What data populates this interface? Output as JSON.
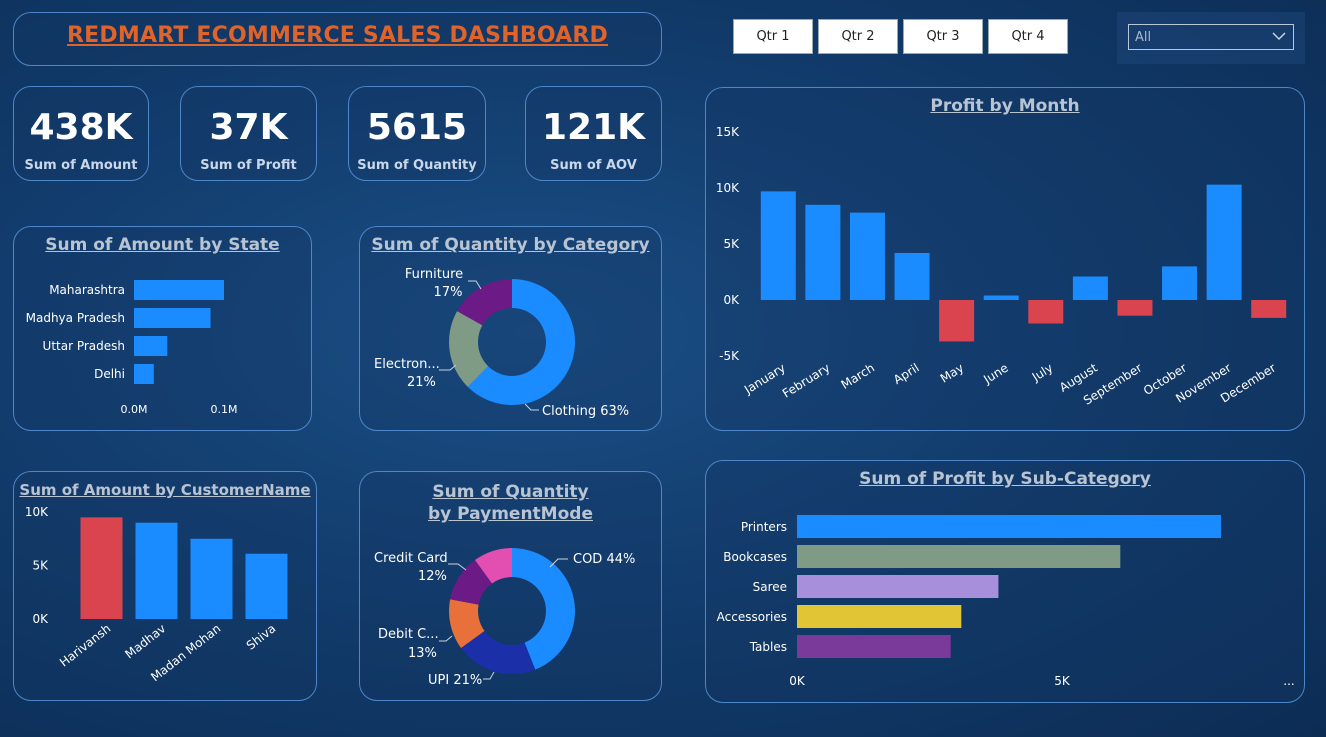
{
  "header": {
    "title": "REDMART ECOMMERCE SALES DASHBOARD"
  },
  "kpis": [
    {
      "value": "438K",
      "label": "Sum of Amount"
    },
    {
      "value": "37K",
      "label": "Sum of Profit"
    },
    {
      "value": "5615",
      "label": "Sum of Quantity"
    },
    {
      "value": "121K",
      "label": "Sum of AOV"
    }
  ],
  "quarter_buttons": [
    "Qtr 1",
    "Qtr 2",
    "Qtr 3",
    "Qtr 4"
  ],
  "slicer": {
    "value": "All"
  },
  "colors": {
    "accent": "#1a8cff",
    "negative": "#d9444f",
    "title_orange": "#e0642a"
  },
  "chart_data": [
    {
      "id": "state",
      "type": "bar",
      "orientation": "horizontal",
      "title": "Sum of Amount by State",
      "categories": [
        "Maharashtra",
        "Madhya Pradesh",
        "Uttar Pradesh",
        "Delhi"
      ],
      "values": [
        0.1,
        0.085,
        0.037,
        0.022
      ],
      "xlim": [
        0,
        0.15
      ],
      "x_ticks": [
        {
          "v": 0,
          "label": "0.0M"
        },
        {
          "v": 0.1,
          "label": "0.1M"
        }
      ]
    },
    {
      "id": "category",
      "type": "pie",
      "donut": true,
      "title": "Sum of Quantity by Category",
      "slices": [
        {
          "label": "Clothing",
          "pct": 63,
          "color": "#1a8cff"
        },
        {
          "label": "Electron...",
          "pct": 21,
          "color": "#7f9a85"
        },
        {
          "label": "Furniture",
          "pct": 17,
          "color": "#6b1a86"
        }
      ]
    },
    {
      "id": "month",
      "type": "bar",
      "title": "Profit by Month",
      "categories": [
        "January",
        "February",
        "March",
        "April",
        "May",
        "June",
        "July",
        "August",
        "September",
        "October",
        "November",
        "December"
      ],
      "values": [
        9700,
        8500,
        7800,
        4200,
        -3700,
        400,
        -2100,
        2100,
        -1400,
        3000,
        10300,
        -1600
      ],
      "ylim": [
        -5000,
        15000
      ],
      "y_ticks": [
        {
          "v": 15000,
          "label": "15K"
        },
        {
          "v": 10000,
          "label": "10K"
        },
        {
          "v": 5000,
          "label": "5K"
        },
        {
          "v": 0,
          "label": "0K"
        },
        {
          "v": -5000,
          "label": "-5K"
        }
      ]
    },
    {
      "id": "customer",
      "type": "bar",
      "title": "Sum of Amount by CustomerName",
      "categories": [
        "Harivansh",
        "Madhav",
        "Madan Mohan",
        "Shiva"
      ],
      "values": [
        9500,
        9000,
        7500,
        6100
      ],
      "highlight_index": 0,
      "ylim": [
        0,
        10000
      ],
      "y_ticks": [
        {
          "v": 10000,
          "label": "10K"
        },
        {
          "v": 5000,
          "label": "5K"
        },
        {
          "v": 0,
          "label": "0K"
        }
      ]
    },
    {
      "id": "payment",
      "type": "pie",
      "donut": true,
      "title": "Sum of Quantity by PaymentMode",
      "slices": [
        {
          "label": "COD",
          "pct": 44,
          "color": "#1a8cff"
        },
        {
          "label": "UPI",
          "pct": 21,
          "color": "#1a2fa8"
        },
        {
          "label": "Debit C...",
          "pct": 13,
          "color": "#e8703a"
        },
        {
          "label": "Credit Card",
          "pct": 12,
          "color": "#6b1a86"
        },
        {
          "label": "",
          "pct": 10,
          "color": "#e34fb0"
        }
      ]
    },
    {
      "id": "subcategory",
      "type": "bar",
      "orientation": "horizontal",
      "title": "Sum of Profit by Sub-Category",
      "categories": [
        "Printers",
        "Bookcases",
        "Saree",
        "Accessories",
        "Tables"
      ],
      "values": [
        8000,
        6100,
        3800,
        3100,
        2900
      ],
      "colors": [
        "#1a8cff",
        "#7f9a85",
        "#a78fdc",
        "#e2c534",
        "#7a3a9a"
      ],
      "xlim": [
        0,
        10000
      ],
      "x_ticks": [
        {
          "v": 0,
          "label": "0K"
        },
        {
          "v": 5000,
          "label": "5K"
        }
      ],
      "overflow_label": "..."
    }
  ]
}
